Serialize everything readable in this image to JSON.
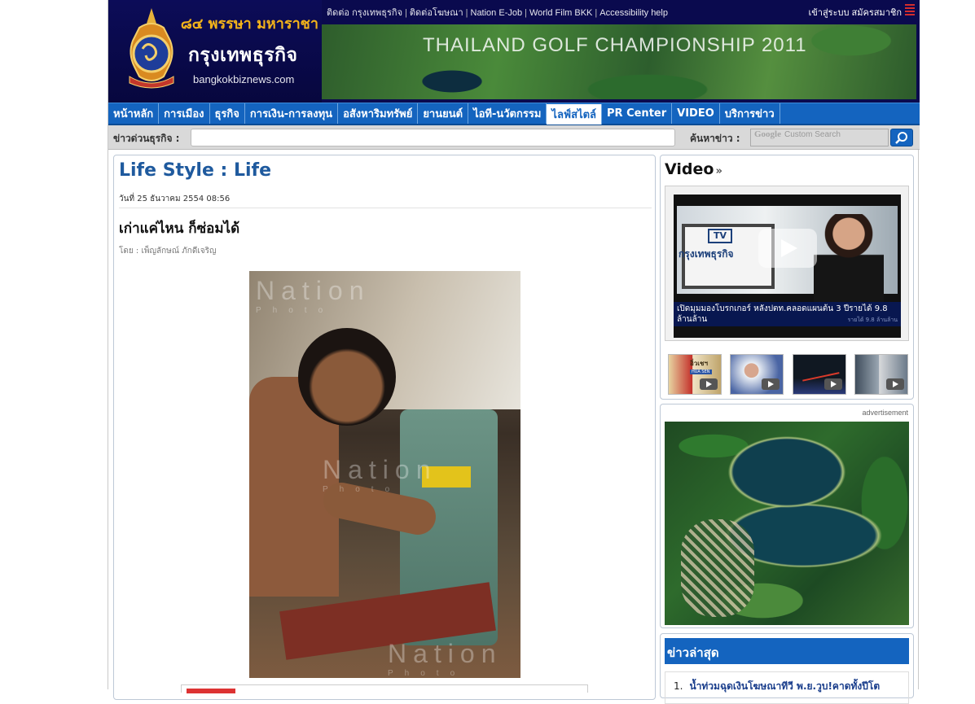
{
  "header": {
    "anniversary": "๘๔ พรรษา มหาราชา",
    "brand": "กรุงเทพธุรกิจ",
    "domain": "bangkokbiznews.com",
    "top_links": [
      "ติดต่อ กรุงเทพธุรกิจ",
      "ติดต่อโฆษณา",
      "Nation E-Job",
      "World Film BKK",
      "Accessibility help"
    ],
    "login": "เข้าสู่ระบบ สมัครสมาชิก",
    "banner_title": "THAILAND GOLF CHAMPIONSHIP 2011"
  },
  "nav": {
    "items": [
      "หน้าหลัก",
      "การเมือง",
      "ธุรกิจ",
      "การเงิน-การลงทุน",
      "อสังหาริมทรัพย์",
      "ยานยนต์",
      "ไอที-นวัตกรรม",
      "ไลฟ์สไตล์",
      "PR Center",
      "VIDEO",
      "บริการข่าว"
    ],
    "active": "ไลฟ์สไตล์"
  },
  "quickbar": {
    "label": "ข่าวด่วนธุรกิจ :",
    "search_label": "ค้นหาข่าว :",
    "search_brand": "Google",
    "search_placeholder": "Custom Search"
  },
  "article": {
    "section": "Life Style : Life",
    "date": "วันที่ 25 ธันวาคม 2554 08:56",
    "headline": "เก่าแค่ไหน ก็ซ่อมได้",
    "byline": "โดย : เพ็ญลักษณ์ ภักดีเจริญ",
    "photo_watermark": "Nation",
    "photo_watermark_sub": "Photo"
  },
  "sidebar": {
    "video_title": "Video",
    "video_chevron": "»",
    "player": {
      "tv_logo": "TV",
      "tv_brand": "กรุงเทพธุรกิจ",
      "caption": "เปิดมุมมองโบรกเกอร์ หลังปตท.คลอดแผนต้น 3 ปีรายได้ 9.8 ล้านล้าน",
      "caption_ghost": "รายได้ 9.8 ล้านล้าน"
    },
    "thumbs": [
      {
        "title": "อิ่วเชฯ",
        "sub": "HUA SEN"
      },
      {
        "title": ""
      },
      {
        "title": ""
      },
      {
        "title": ""
      }
    ],
    "ad_label": "advertisement",
    "latest_title": "ข่าวล่าสุด",
    "latest_items": [
      {
        "num": "1.",
        "text": "น้ำท่วมฉุดเงินโฆษณาทีวี พ.ย.วูบ!คาดทั้งปีโต"
      }
    ]
  }
}
